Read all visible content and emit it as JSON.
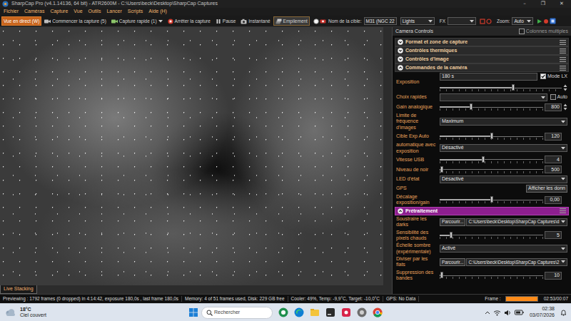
{
  "window": {
    "title": "SharpCap Pro (v4.1.14136, 64 bit) - ATR2600M - C:\\Users\\beck\\Desktop\\SharpCap Captures",
    "controls": [
      "–",
      "❐",
      "✕"
    ]
  },
  "menu": [
    "Fichier",
    "Caméras",
    "Capture",
    "Vue",
    "Outils",
    "Lancer",
    "Scripts",
    "Aide (H)"
  ],
  "toolbar": {
    "buttons": [
      {
        "label": "Vue en direct (W)",
        "selected": true,
        "kind": "mode"
      },
      {
        "label": "Commencer la capture (5)",
        "selected": false,
        "kind": "tool"
      },
      {
        "label": "Capture rapide (1)",
        "selected": false,
        "kind": "split"
      },
      {
        "label": "Arrêter la capture",
        "selected": false,
        "kind": "tool"
      },
      {
        "label": "Pause",
        "selected": false,
        "kind": "tool"
      },
      {
        "label": "Instantané",
        "selected": false,
        "kind": "tool"
      },
      {
        "label": "Empilement",
        "selected": true,
        "kind": "tool"
      }
    ],
    "target": {
      "label": "Nom de la cible:",
      "value": "M31 (NGC 22"
    },
    "frame_type": {
      "value": "Lights"
    },
    "fx": {
      "label": "FX"
    },
    "zoom": {
      "label": "Zoom:",
      "value": "Auto"
    }
  },
  "image_tabs": [
    {
      "label": "Live Stacking",
      "selected": true
    }
  ],
  "panel": {
    "title": "Camera Controls",
    "multi_columns": {
      "label": "Colonnes multiples",
      "checked": false
    },
    "sections": [
      {
        "title": "Format et zone de capture",
        "expanded": false,
        "highlighted": false,
        "rows": []
      },
      {
        "title": "Contrôles thermiques",
        "expanded": false,
        "highlighted": false,
        "rows": []
      },
      {
        "title": "Contrôles d'image",
        "expanded": false,
        "highlighted": false,
        "rows": []
      },
      {
        "title": "Commandes de la caméra",
        "expanded": true,
        "highlighted": false,
        "rows": [
          {
            "kind": "exposure",
            "label": "Exposition",
            "value": "180 s",
            "check": {
              "label": "Mode LX",
              "checked": true
            },
            "level": 0.6,
            "spinner": true
          },
          {
            "kind": "select_check",
            "label": "Choix rapides",
            "check": {
              "label": "Auto",
              "checked": false
            }
          },
          {
            "kind": "slider",
            "label": "Gain analogique",
            "level": 0.3,
            "value": "800",
            "spinner": true
          },
          {
            "kind": "select",
            "label": "Limite de fréquence d'images",
            "value": "Maximum"
          },
          {
            "kind": "slider",
            "label": "Cible Exp Auto",
            "level": 0.5,
            "value": "120",
            "spinner": false
          },
          {
            "kind": "select",
            "label": "automatique avec exposition",
            "value": "Désactivé"
          },
          {
            "kind": "slider",
            "label": "Vitesse USB",
            "level": 0.42,
            "value": "4",
            "spinner": false
          },
          {
            "kind": "slider",
            "label": "Niveau de noir",
            "level": 0.02,
            "value": "500",
            "spinner": false
          },
          {
            "kind": "select",
            "label": "LED d'état",
            "value": "Désactivé"
          },
          {
            "kind": "button",
            "label": "GPS",
            "value": "Afficher les donn"
          },
          {
            "kind": "slider",
            "label": "Décalage exposition/gain",
            "level": 0.5,
            "value": "0,00",
            "spinner": false
          }
        ]
      },
      {
        "title": "Prétraitement",
        "expanded": true,
        "highlighted": true,
        "rows": [
          {
            "kind": "file",
            "label": "Soustraire les darks",
            "button": "Parcourir...",
            "value": "C:\\Users\\beck\\Desktop\\SharpCap Captures\\d"
          },
          {
            "kind": "slider",
            "label": "Sensibilité des pixels chauds",
            "level": 0.11,
            "value": "5",
            "spinner": false
          },
          {
            "kind": "select",
            "label": "Échelle sombre (expérimentale)",
            "value": "Activé"
          },
          {
            "kind": "file",
            "label": "Diviser par les flats",
            "button": "Parcourir...",
            "value": "C:\\Users\\beck\\Desktop\\SharpCap Captures\\2"
          },
          {
            "kind": "slider",
            "label": "Suppression des bandes",
            "level": 0.02,
            "value": "10",
            "spinner": false
          }
        ]
      }
    ]
  },
  "status_bar": {
    "preview": "Previewing : 1792 frames (0 dropped) in 4:14:42, exposure 180,0s , last frame 180,0s",
    "memory": "Memory: 4 of 51 frames used, Disk: 229 GB free",
    "cooler": "Cooler: 49%, Temp: -9,9°C, Target: -10,0°C",
    "gps": "GPS: No Data",
    "frame": {
      "label": "Frame :",
      "level": 1
    },
    "time": "02:53/00:07"
  },
  "taskbar": {
    "weather": {
      "temp": "18°C",
      "desc": "Ciel couvert"
    },
    "search": {
      "placeholder": "Rechercher"
    },
    "clock": {
      "time": "02:38",
      "date": "03/07/2026"
    }
  }
}
